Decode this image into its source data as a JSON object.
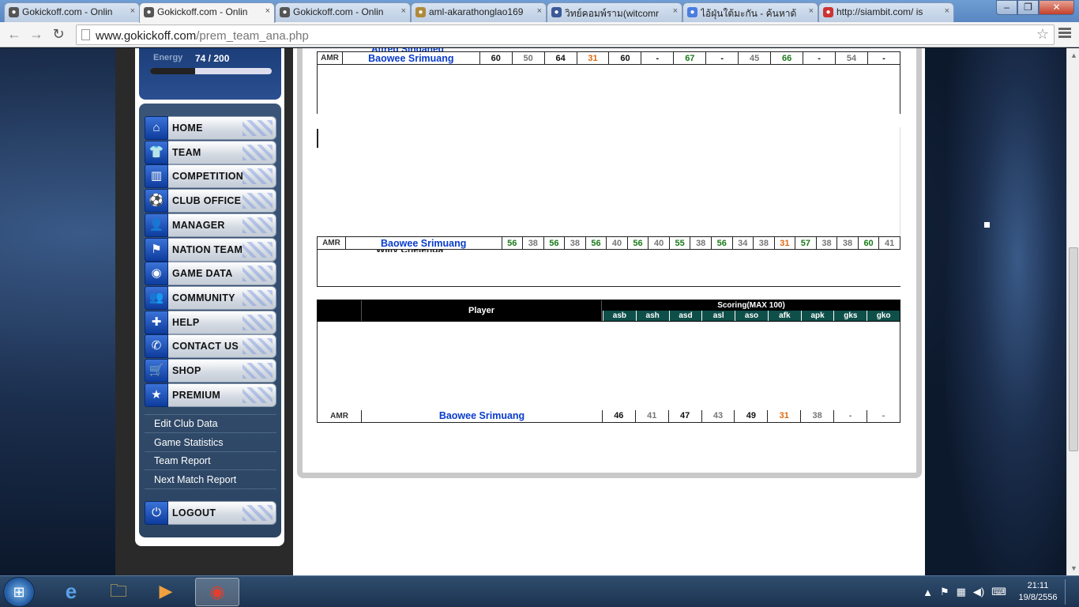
{
  "browser": {
    "tabs": [
      {
        "title": "Gokickoff.com - Onlin",
        "active": false,
        "icon": "football-player-icon"
      },
      {
        "title": "Gokickoff.com - Onlin",
        "active": true,
        "icon": "football-player-icon"
      },
      {
        "title": "Gokickoff.com - Onlin",
        "active": false,
        "icon": "football-player-icon"
      },
      {
        "title": "aml-akarathonglao169",
        "active": false,
        "icon": "image-file-icon"
      },
      {
        "title": "วิทย์คอมพ์ราม(witcomr",
        "active": false,
        "icon": "facebook-icon"
      },
      {
        "title": "ไอ้ฝุ่นใต้มะกัน - ค้นหาด้",
        "active": false,
        "icon": "google-icon"
      },
      {
        "title": "http://siambit.com/ is",
        "active": false,
        "icon": "thai-flag-icon"
      }
    ],
    "url_domain": "www.gokickoff.com",
    "url_path": "/prem_team_ana.php",
    "window_controls": {
      "minimize": "–",
      "maximize": "❐",
      "close": "✕"
    }
  },
  "energy": {
    "label": "Energy",
    "value": "74 / 200",
    "fraction": 0.37
  },
  "menu": [
    {
      "label": "HOME",
      "icon": "home-icon",
      "glyph": "⌂"
    },
    {
      "label": "TEAM",
      "icon": "shirt-icon",
      "glyph": "👕"
    },
    {
      "label": "COMPETITION",
      "icon": "podium-icon",
      "glyph": "▥"
    },
    {
      "label": "CLUB OFFICE",
      "icon": "football-icon",
      "glyph": "⚽"
    },
    {
      "label": "MANAGER",
      "icon": "manager-icon",
      "glyph": "👤"
    },
    {
      "label": "NATION TEAM",
      "icon": "flag-icon",
      "glyph": "⚑"
    },
    {
      "label": "GAME DATA",
      "icon": "database-icon",
      "glyph": "◉"
    },
    {
      "label": "COMMUNITY",
      "icon": "community-icon",
      "glyph": "👥"
    },
    {
      "label": "HELP",
      "icon": "lifebuoy-icon",
      "glyph": "✚"
    },
    {
      "label": "CONTACT US",
      "icon": "phone-icon",
      "glyph": "✆"
    },
    {
      "label": "SHOP",
      "icon": "cart-icon",
      "glyph": "🛒"
    },
    {
      "label": "PREMIUM",
      "icon": "star-icon",
      "glyph": "★"
    }
  ],
  "submenu": [
    "Edit Club Data",
    "Game Statistics",
    "Team Report",
    "Next Match Report"
  ],
  "logout": {
    "label": "LOGOUT",
    "icon": "power-icon",
    "glyph": "⏻"
  },
  "table1": {
    "partial_name": "Alfred Sihdahed",
    "row": {
      "pos": "AMR",
      "name": "Baowee Srimuang",
      "values": [
        "60",
        "50",
        "64",
        "31",
        "60",
        "-",
        "67",
        "-",
        "45",
        "66",
        "-",
        "54",
        "-"
      ],
      "colors": [
        "black",
        "gray",
        "black",
        "orange",
        "black",
        "black",
        "green",
        "black",
        "gray",
        "green",
        "black",
        "gray",
        "black"
      ]
    }
  },
  "table2": {
    "partial_name": "Willy Chelenga",
    "row": {
      "pos": "AMR",
      "name": "Baowee Srimuang",
      "values": [
        "56",
        "38",
        "56",
        "38",
        "56",
        "40",
        "56",
        "40",
        "55",
        "38",
        "56",
        "34",
        "38",
        "31",
        "57",
        "38",
        "38",
        "60",
        "41"
      ],
      "colors": [
        "green",
        "gray",
        "green",
        "gray",
        "green",
        "gray",
        "green",
        "gray",
        "green",
        "gray",
        "green",
        "gray",
        "gray",
        "orange",
        "green",
        "gray",
        "gray",
        "green",
        "gray"
      ]
    }
  },
  "table3": {
    "player_header": "Player",
    "scoring_header": "Scoring(MAX 100)",
    "columns": [
      "asb",
      "ash",
      "asd",
      "asl",
      "aso",
      "afk",
      "apk",
      "gks",
      "gko"
    ],
    "row": {
      "pos": "AMR",
      "name": "Baowee Srimuang",
      "values": [
        "46",
        "41",
        "47",
        "43",
        "49",
        "31",
        "38",
        "-",
        "-"
      ],
      "colors": [
        "black",
        "gray",
        "black",
        "gray",
        "black",
        "orange",
        "gray",
        "gray",
        "gray"
      ]
    }
  },
  "taskbar": {
    "apps": [
      {
        "name": "internet-explorer-icon",
        "glyph": "e",
        "active": false
      },
      {
        "name": "file-explorer-icon",
        "glyph": "🗀",
        "active": false
      },
      {
        "name": "media-player-icon",
        "glyph": "▶",
        "active": false
      },
      {
        "name": "chrome-icon",
        "glyph": "◉",
        "active": true
      }
    ],
    "time": "21:11",
    "date": "19/8/2556"
  },
  "colors": {
    "accent_blue": "#0a3ccc",
    "good": "#1a7a1a",
    "warn": "#e06a10",
    "neutral": "#777777",
    "table_header": "#000000",
    "scoring_cols": "#0f4f4a"
  }
}
